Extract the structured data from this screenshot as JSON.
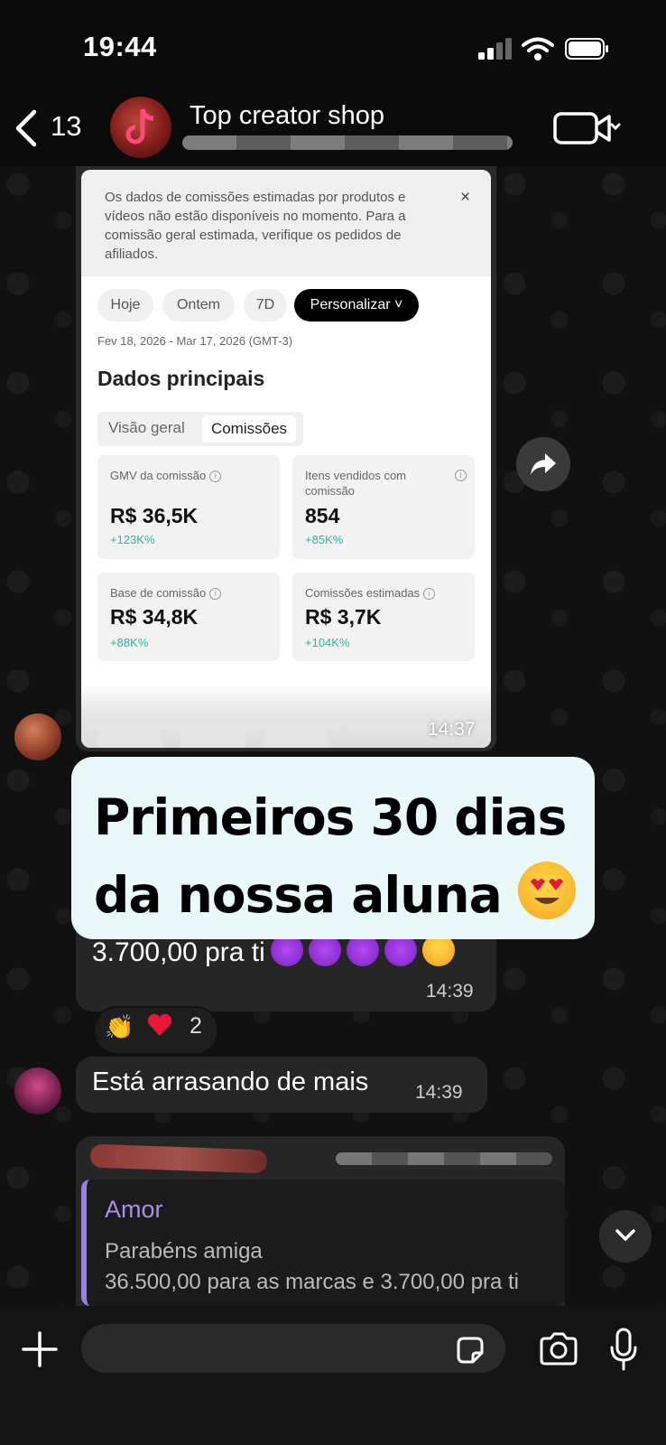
{
  "status": {
    "time": "19:44"
  },
  "header": {
    "back_count": "13",
    "title": "Top creator shop"
  },
  "screenshot": {
    "notice": "Os dados de comissões estimadas por produtos e vídeos não estão disponíveis no momento. Para a comissão geral estimada, verifique os pedidos de afiliados.",
    "close": "×",
    "chips": [
      "Hoje",
      "Ontem",
      "7D",
      "Personalizar ˅"
    ],
    "date_range": "Fev 18, 2026 - Mar 17, 2026 (GMT-3)",
    "section_title": "Dados principais",
    "segments": [
      "Visão geral",
      "Comissões"
    ],
    "cards": [
      {
        "label": "GMV da comissão",
        "value": "R$ 36,5K",
        "change": "+123K%"
      },
      {
        "label": "Itens vendidos com comissão",
        "value": "854",
        "change": "+85K%"
      },
      {
        "label": "Base de comissão",
        "value": "R$ 34,8K",
        "change": "+88K%"
      },
      {
        "label": "Comissões estimadas",
        "value": "R$ 3,7K",
        "change": "+104K%"
      }
    ],
    "time": "14:37"
  },
  "overlay": {
    "line1": "Primeiros 30 dias",
    "line2": "da nossa aluna"
  },
  "messages": {
    "m1_text": "3.700,00 pra ti",
    "m1_time": "14:39",
    "reaction_count": "2",
    "m2_text": "Está arrasando de mais",
    "m2_time": "14:39",
    "reply_name": "Amor",
    "reply_line1": "Parabéns amiga",
    "reply_line2": "36.500,00 para as marcas e 3.700,00 pra ti"
  },
  "icons": {
    "back": "chevron-left-icon",
    "video": "video-call-icon",
    "forward": "forward-icon",
    "scroll": "chevron-down-icon",
    "plus": "plus-icon",
    "sticker": "sticker-icon",
    "camera": "camera-icon",
    "mic": "microphone-icon"
  },
  "colors": {
    "accent_teal": "#2bb5a8",
    "reply_purple": "#a98ee8",
    "overlay_bg": "#e9f8f8"
  }
}
